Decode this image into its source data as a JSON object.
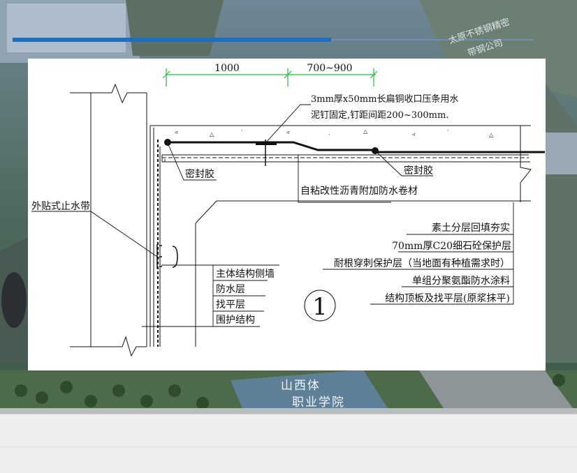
{
  "watermark": {
    "company_line1": "太原不锈钢精密",
    "company_line2": "带钢公司",
    "campus_line1": "山西体",
    "campus_line2": "职业学院"
  },
  "drawing": {
    "dim_left": "1000",
    "dim_right": "700~900",
    "note_strip_line1": "3mm厚x50mm长扁铜收口压条用水",
    "note_strip_line2": "泥钉固定,钉距间距200~300mm.",
    "sealant_left": "密封胶",
    "sealant_right": "密封胶",
    "membrane": "自粘改性沥青附加防水卷材",
    "waterstop": "外贴式止水带",
    "roof_layers": [
      "素土分层回填夯实",
      "70mm厚C20细石砼保护层",
      "耐根穿刺保护层（当地面有种植需求时）",
      "单组分聚氨酯防水涂料",
      "结构顶板及找平层(原浆抹平)"
    ],
    "wall_layers": [
      "主体结构侧墙",
      "防水层",
      "找平层",
      "围护结构"
    ],
    "detail_number": "1"
  }
}
